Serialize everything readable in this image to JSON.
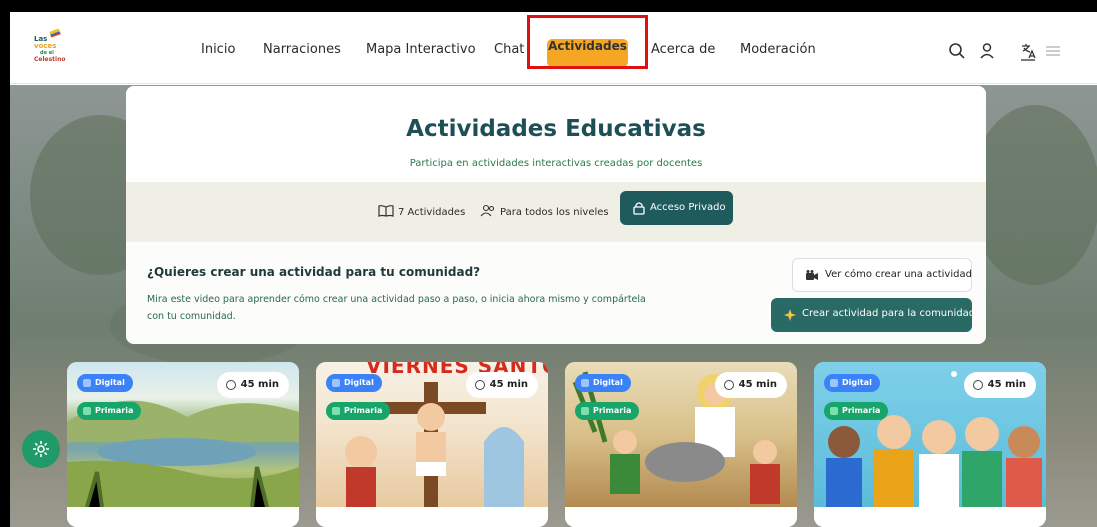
{
  "logo": {
    "line1": "Las",
    "line2": "voces",
    "line3": "de el",
    "line4": "Celestino"
  },
  "nav": {
    "items": [
      "Inicio",
      "Narraciones",
      "Mapa Interactivo",
      "Chat",
      "Actividades",
      "Acerca de",
      "Moderación"
    ],
    "active": "Actividades"
  },
  "header_icons": [
    "search-icon",
    "user-icon",
    "translate-icon",
    "menu-icon"
  ],
  "hero": {
    "title": "Actividades Educativas",
    "subtitle": "Participa en actividades interactivas creadas por docentes"
  },
  "stats": {
    "activities": "7 Actividades",
    "levels": "Para todos los niveles",
    "private_button": "Acceso Privado"
  },
  "cta": {
    "title": "¿Quieres crear una actividad para tu comunidad?",
    "text": "Mira este video para aprender cómo crear una actividad paso a paso, o inicia ahora mismo y compártela con tu comunidad.",
    "video_button": "Ver cómo crear una actividad",
    "create_button": "Crear actividad para la comunidad"
  },
  "activity_cards": [
    {
      "format": "Digital",
      "level": "Primaria",
      "duration": "45 min"
    },
    {
      "format": "Digital",
      "level": "Primaria",
      "duration": "45 min",
      "image_text": "VIERNES SANTO"
    },
    {
      "format": "Digital",
      "level": "Primaria",
      "duration": "45 min"
    },
    {
      "format": "Digital",
      "level": "Primaria",
      "duration": "45 min"
    }
  ],
  "colors": {
    "accent": "#f5a623",
    "primary_dark": "#1f5a5c",
    "green": "#18a56a",
    "highlight": "#e01010"
  }
}
